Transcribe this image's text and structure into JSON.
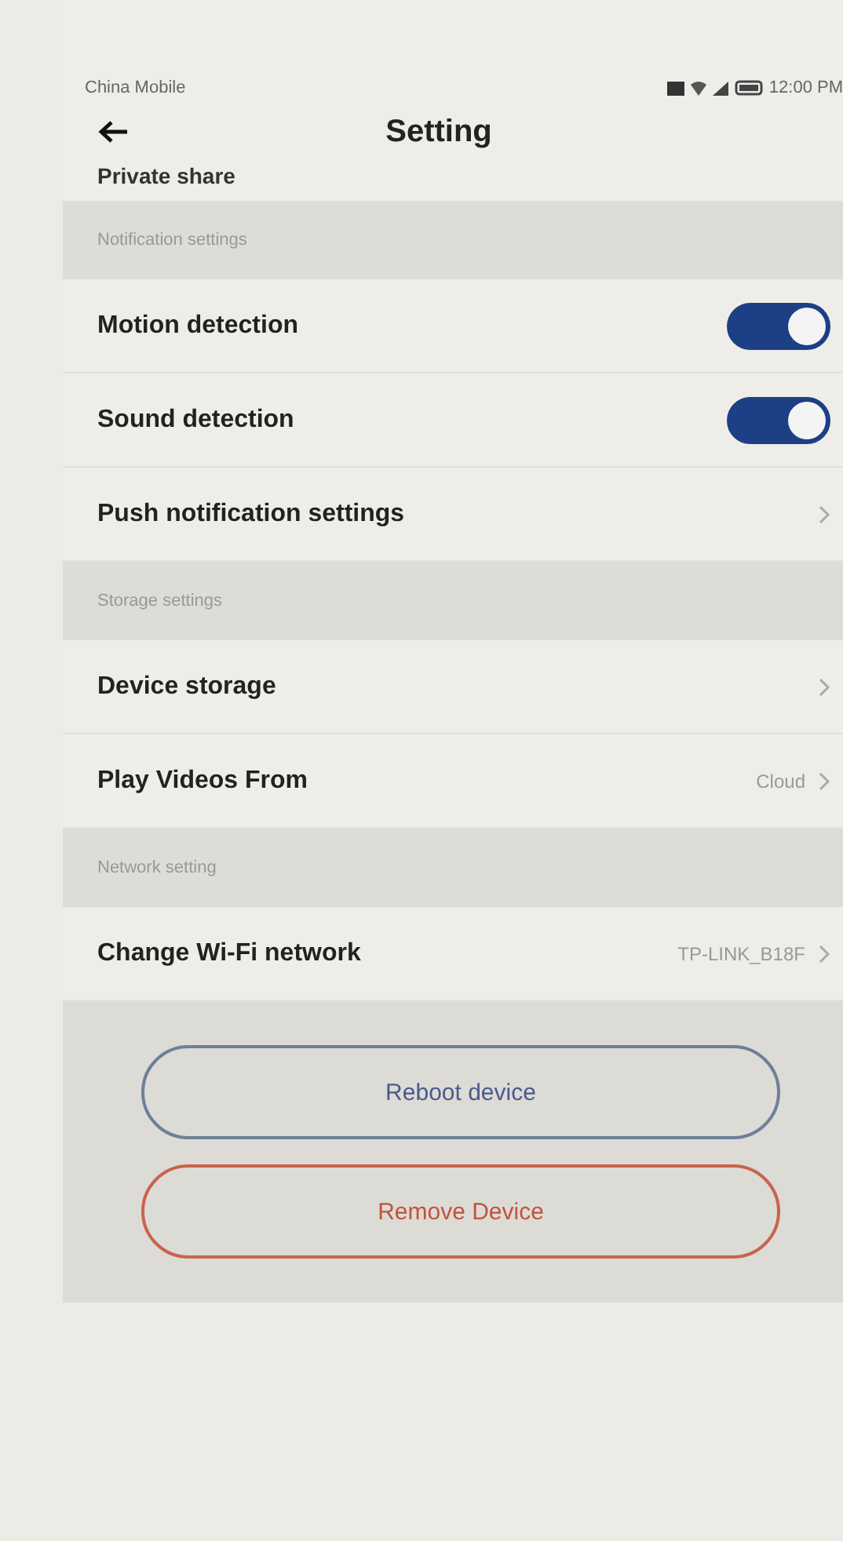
{
  "status_bar": {
    "carrier": "China Mobile",
    "time": "12:00 PM"
  },
  "header": {
    "title": "Setting"
  },
  "partial_row": {
    "label": "Private share"
  },
  "sections": [
    {
      "title": "Notification settings",
      "items": [
        {
          "kind": "toggle",
          "label": "Motion detection",
          "on": true
        },
        {
          "kind": "toggle",
          "label": "Sound detection",
          "on": true
        },
        {
          "kind": "link",
          "label": "Push notification settings"
        }
      ]
    },
    {
      "title": "Storage settings",
      "items": [
        {
          "kind": "link",
          "label": "Device storage"
        },
        {
          "kind": "link",
          "label": "Play Videos From",
          "value": "Cloud"
        }
      ]
    },
    {
      "title": "Network setting",
      "items": [
        {
          "kind": "link",
          "label": "Change Wi-Fi network",
          "value": "TP-LINK_B18F"
        }
      ]
    }
  ],
  "buttons": [
    {
      "kind": "neutral",
      "label": "Reboot device"
    },
    {
      "kind": "danger",
      "label": "Remove Device"
    }
  ]
}
